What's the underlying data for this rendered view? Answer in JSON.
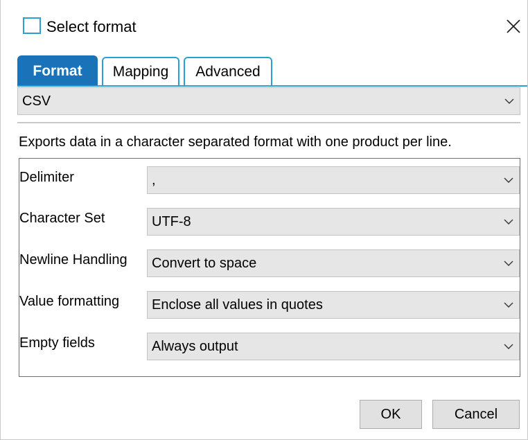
{
  "window": {
    "title": "Select format",
    "close_icon": "close-icon"
  },
  "tabs": [
    {
      "label": "Format",
      "active": true
    },
    {
      "label": "Mapping",
      "active": false
    },
    {
      "label": "Advanced",
      "active": false
    }
  ],
  "format": {
    "selected": "CSV",
    "description": "Exports data in a character separated format with one product per line."
  },
  "fields": [
    {
      "label": "Delimiter",
      "value": ","
    },
    {
      "label": "Character Set",
      "value": "UTF-8"
    },
    {
      "label": "Newline Handling",
      "value": "Convert to space"
    },
    {
      "label": "Value formatting",
      "value": "Enclose all values in quotes"
    },
    {
      "label": "Empty fields",
      "value": "Always output"
    }
  ],
  "buttons": {
    "ok": "OK",
    "cancel": "Cancel"
  },
  "colors": {
    "accent": "#2a9fd6",
    "active_tab": "#1a73b8",
    "control_bg": "#e6e6e6"
  }
}
